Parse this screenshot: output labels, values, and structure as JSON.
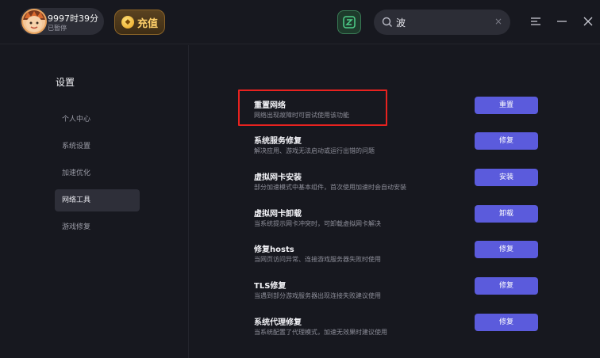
{
  "header": {
    "user": {
      "time_remaining": "9997时39分",
      "status": "已暂停"
    },
    "recharge_label": "充值",
    "search": {
      "value": "波",
      "clear_glyph": "×"
    },
    "window_controls": [
      "menu-icon",
      "minimize-icon",
      "close-icon"
    ]
  },
  "sidebar": {
    "title": "设置",
    "items": [
      {
        "label": "个人中心",
        "active": false
      },
      {
        "label": "系统设置",
        "active": false
      },
      {
        "label": "加速优化",
        "active": false
      },
      {
        "label": "网络工具",
        "active": true
      },
      {
        "label": "游戏修复",
        "active": false
      }
    ]
  },
  "tools": [
    {
      "title": "重置网络",
      "desc": "网络出现故障时可尝试使用该功能",
      "button": "重置"
    },
    {
      "title": "系统服务修复",
      "desc": "解决应用、游戏无法启动或运行出错的问题",
      "button": "修复"
    },
    {
      "title": "虚拟网卡安装",
      "desc": "部分加速模式中基本组件，首次使用加速时会自动安装",
      "button": "安装"
    },
    {
      "title": "虚拟网卡卸载",
      "desc": "当系统提示网卡冲突时，可卸载虚拟网卡解决",
      "button": "卸载"
    },
    {
      "title": "修复hosts",
      "desc": "当网页访问异常、连接游戏服务器失败时使用",
      "button": "修复"
    },
    {
      "title": "TLS修复",
      "desc": "当遇到部分游戏服务器出现连接失败建议使用",
      "button": "修复"
    },
    {
      "title": "系统代理修复",
      "desc": "当系统配置了代理模式，加速无效果时建议使用",
      "button": "修复"
    }
  ],
  "colors": {
    "background": "#17181f",
    "accent_button": "#5b5bdc",
    "highlight": "#e8221f",
    "recharge_text": "#ffd06a"
  }
}
